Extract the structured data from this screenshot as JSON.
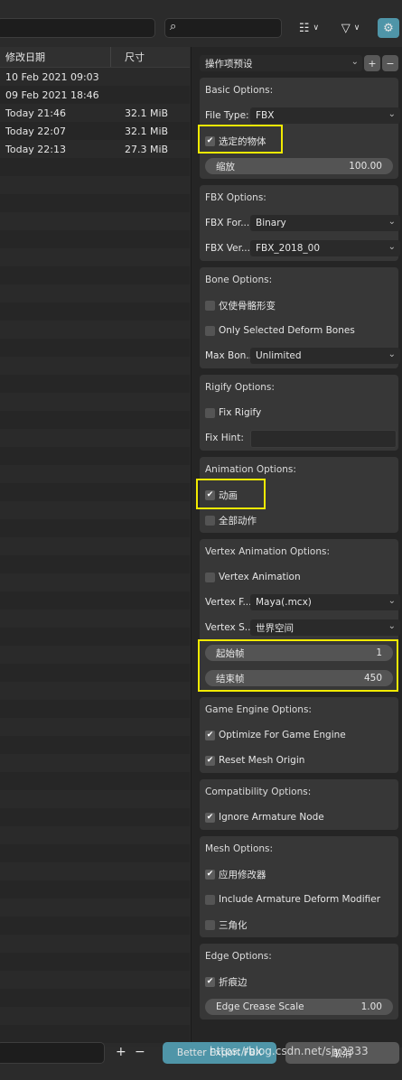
{
  "topbar": {
    "search_placeholder": "",
    "display_icon": "display-mode-icon",
    "filter_icon": "filter-icon",
    "settings_icon": "gear-icon"
  },
  "filelist": {
    "col_date": "修改日期",
    "col_size": "尺寸",
    "rows": [
      {
        "date": "10 Feb 2021 09:03",
        "size": ""
      },
      {
        "date": "09 Feb 2021 18:46",
        "size": ""
      },
      {
        "date": "Today 21:46",
        "size": "32.1 MiB"
      },
      {
        "date": "Today 22:07",
        "size": "32.1 MiB"
      },
      {
        "date": "Today 22:13",
        "size": "27.3 MiB"
      }
    ]
  },
  "presets": {
    "label": "操作项预设",
    "add": "+",
    "remove": "−"
  },
  "basic": {
    "title": "Basic Options:",
    "file_type_label": "File Type:",
    "file_type_value": "FBX",
    "selected_objects": "选定的物体",
    "scale_label": "缩放",
    "scale_value": "100.00"
  },
  "fbx": {
    "title": "FBX Options:",
    "format_label": "FBX For...",
    "format_value": "Binary",
    "version_label": "FBX Ver...",
    "version_value": "FBX_2018_00"
  },
  "bone": {
    "title": "Bone Options:",
    "deform_only": "仅使骨骼形变",
    "only_selected_deform": "Only Selected Deform Bones",
    "max_bone_label": "Max Bon...",
    "max_bone_value": "Unlimited"
  },
  "rigify": {
    "title": "Rigify Options:",
    "fix_rigify": "Fix Rigify",
    "fix_hint_label": "Fix Hint:",
    "fix_hint_value": ""
  },
  "animation": {
    "title": "Animation Options:",
    "animation": "动画",
    "all_actions": "全部动作"
  },
  "vertex": {
    "title": "Vertex Animation Options:",
    "vertex_animation": "Vertex Animation",
    "format_label": "Vertex F...",
    "format_value": "Maya(.mcx)",
    "space_label": "Vertex S...",
    "space_value": "世界空间",
    "start_label": "起始帧",
    "start_value": "1",
    "end_label": "结束帧",
    "end_value": "450"
  },
  "game": {
    "title": "Game Engine Options:",
    "optimize": "Optimize For Game Engine",
    "reset_origin": "Reset Mesh Origin"
  },
  "compat": {
    "title": "Compatibility Options:",
    "ignore_armature": "Ignore Armature Node"
  },
  "mesh": {
    "title": "Mesh Options:",
    "apply_modifiers": "应用修改器",
    "include_armature_deform": "Include Armature Deform Modifier",
    "triangulate": "三角化"
  },
  "edge": {
    "title": "Edge Options:",
    "crease": "折痕边",
    "crease_scale_label": "Edge Crease Scale",
    "crease_scale_value": "1.00"
  },
  "bottom": {
    "plus": "+",
    "minus": "−",
    "export_button": "Better Export FBX",
    "cancel_button": "取消",
    "watermark": "https://blog.csdn.net/sjy2333"
  },
  "colors": {
    "accent": "#4f95a8",
    "highlight": "#f2ea00"
  }
}
